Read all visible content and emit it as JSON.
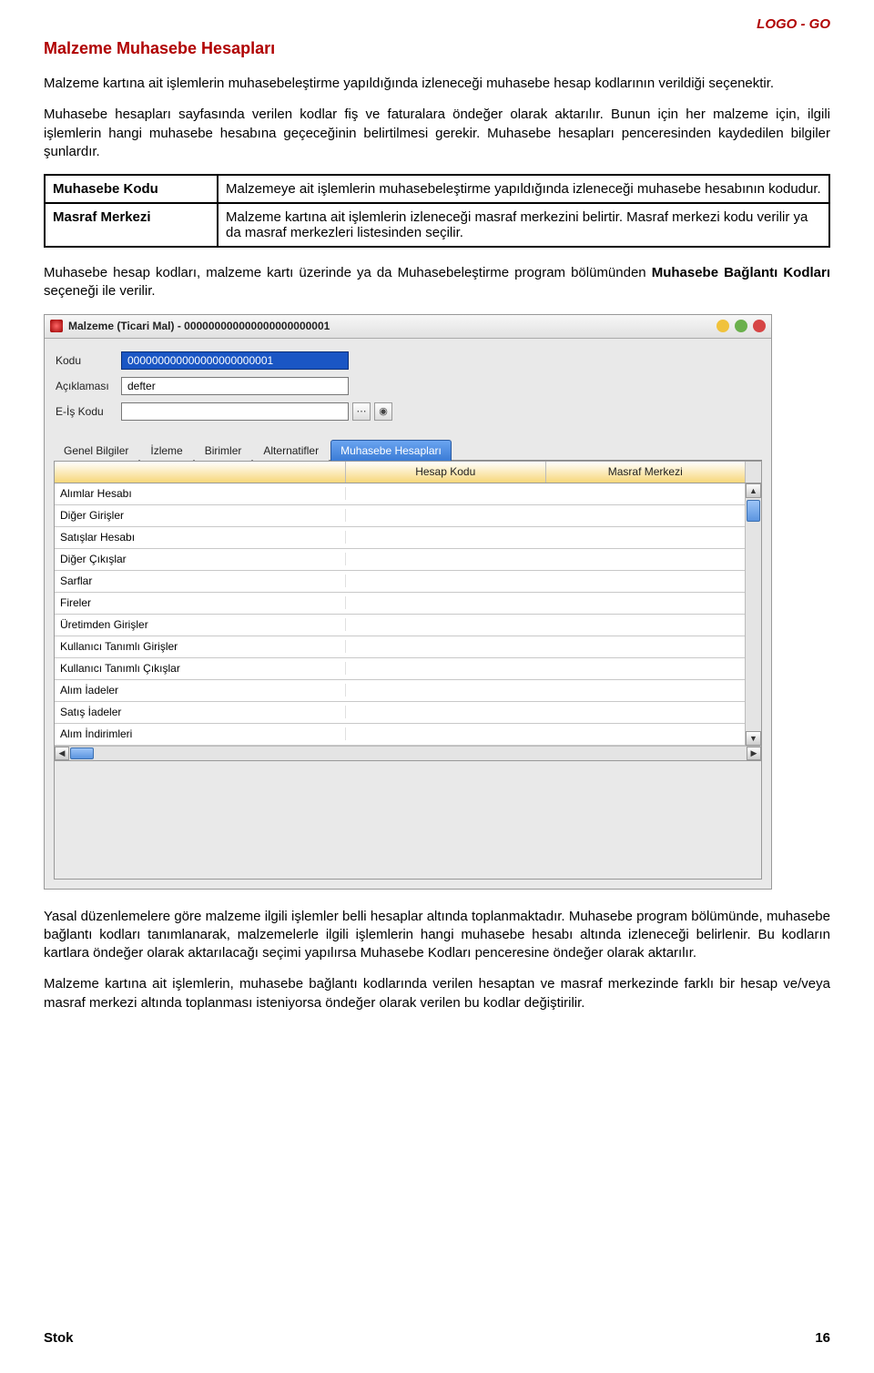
{
  "header": {
    "brand": "LOGO - GO"
  },
  "title": "Malzeme Muhasebe Hesapları",
  "para1": "Malzeme kartına ait işlemlerin muhasebeleştirme yapıldığında izleneceği muhasebe hesap kodlarının verildiği seçenektir.",
  "para2": "Muhasebe hesapları sayfasında verilen kodlar fiş ve faturalara öndeğer olarak aktarılır. Bunun için her malzeme için, ilgili işlemlerin hangi muhasebe hesabına geçeceğinin belirtilmesi gerekir. Muhasebe hesapları penceresinden kaydedilen bilgiler şunlardır.",
  "defs": {
    "r1k": "Muhasebe Kodu",
    "r1v": "Malzemeye ait işlemlerin muhasebeleştirme yapıldığında izleneceği muhasebe hesabının kodudur.",
    "r2k": "Masraf Merkezi",
    "r2v": "Malzeme kartına ait işlemlerin izleneceği masraf merkezini belirtir. Masraf merkezi kodu verilir ya da masraf merkezleri listesinden seçilir."
  },
  "para3_pre": "Muhasebe hesap kodları, malzeme kartı üzerinde ya da Muhasebeleştirme program bölümünden ",
  "para3_bold": "Muhasebe Bağlantı Kodları",
  "para3_post": " seçeneği ile verilir.",
  "window": {
    "title": "Malzeme (Ticari Mal) - 000000000000000000000001",
    "form": {
      "kodu_label": "Kodu",
      "kodu_value": "000000000000000000000001",
      "aciklama_label": "Açıklaması",
      "aciklama_value": "defter",
      "eis_label": "E-İş Kodu",
      "eis_value": ""
    },
    "tabs": [
      "Genel Bilgiler",
      "İzleme",
      "Birimler",
      "Alternatifler",
      "Muhasebe Hesapları"
    ],
    "active_tab": 4,
    "grid": {
      "headers": [
        "",
        "Hesap Kodu",
        "Masraf Merkezi"
      ],
      "rows": [
        "Alımlar Hesabı",
        "Diğer Girişler",
        "Satışlar Hesabı",
        "Diğer Çıkışlar",
        "Sarflar",
        "Fireler",
        "Üretimden Girişler",
        "Kullanıcı Tanımlı Girişler",
        "Kullanıcı Tanımlı Çıkışlar",
        "Alım İadeler",
        "Satış İadeler",
        "Alım İndirimleri"
      ]
    }
  },
  "para4": "Yasal düzenlemelere göre malzeme ilgili işlemler belli hesaplar altında toplanmaktadır. Muhasebe program bölümünde, muhasebe bağlantı kodları tanımlanarak, malzemelerle ilgili işlemlerin hangi muhasebe hesabı altında izleneceği belirlenir. Bu kodların kartlara öndeğer olarak aktarılacağı seçimi yapılırsa Muhasebe Kodları penceresine öndeğer olarak aktarılır.",
  "para5": "Malzeme kartına ait işlemlerin, muhasebe bağlantı kodlarında verilen hesaptan ve masraf merkezinde farklı bir hesap ve/veya masraf merkezi altında toplanması isteniyorsa öndeğer olarak verilen bu kodlar değiştirilir.",
  "footer": {
    "left": "Stok",
    "right": "16"
  }
}
